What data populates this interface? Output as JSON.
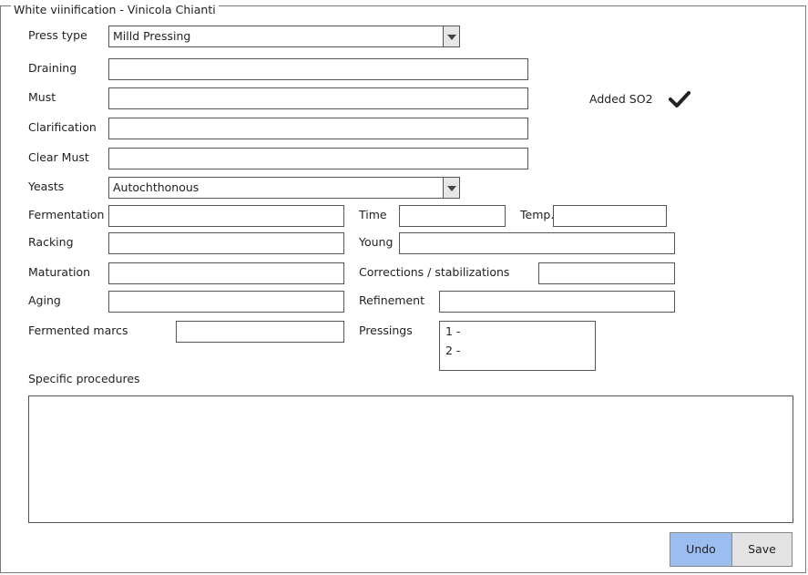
{
  "frame": {
    "title": "White viinification - Vinicola Chianti"
  },
  "fields": {
    "press_type": {
      "label": "Press type",
      "value": "Milld Pressing"
    },
    "draining": {
      "label": "Draining",
      "value": ""
    },
    "must": {
      "label": "Must",
      "value": ""
    },
    "clarification": {
      "label": "Clarification",
      "value": ""
    },
    "clear_must": {
      "label": "Clear Must",
      "value": ""
    },
    "yeasts": {
      "label": "Yeasts",
      "value": "Autochthonous"
    },
    "fermentation": {
      "label": "Fermentation",
      "value": ""
    },
    "time": {
      "label": "Time",
      "value": ""
    },
    "temp": {
      "label": "Temp.",
      "value": ""
    },
    "racking": {
      "label": "Racking",
      "value": ""
    },
    "young": {
      "label": "Young",
      "value": ""
    },
    "maturation": {
      "label": "Maturation",
      "value": ""
    },
    "corrections": {
      "label": "Corrections / stabilizations",
      "value": ""
    },
    "aging": {
      "label": "Aging",
      "value": ""
    },
    "refinement": {
      "label": "Refinement",
      "value": ""
    },
    "fermented_marcs": {
      "label": "Fermented marcs",
      "value": ""
    },
    "pressings": {
      "label": "Pressings",
      "items": [
        "1  -",
        "2  -"
      ]
    },
    "specific_procedures": {
      "label": "Specific procedures",
      "value": ""
    }
  },
  "added_so2": {
    "label": "Added SO2",
    "checked": true,
    "icon": "checkmark-icon"
  },
  "buttons": {
    "undo": "Undo",
    "save": "Save"
  },
  "colors": {
    "undo_button": "#9cbdf0",
    "save_button": "#e3e3e3",
    "border": "#555555"
  }
}
